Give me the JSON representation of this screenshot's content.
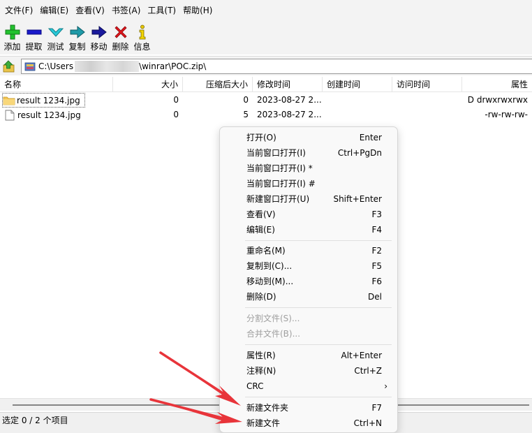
{
  "menubar": [
    "文件(F)",
    "编辑(E)",
    "查看(V)",
    "书签(A)",
    "工具(T)",
    "帮助(H)"
  ],
  "toolbar": [
    {
      "label": "添加",
      "icon": "add-icon"
    },
    {
      "label": "提取",
      "icon": "extract-icon"
    },
    {
      "label": "测试",
      "icon": "test-icon"
    },
    {
      "label": "复制",
      "icon": "copy-icon"
    },
    {
      "label": "移动",
      "icon": "move-icon"
    },
    {
      "label": "删除",
      "icon": "delete-icon"
    },
    {
      "label": "信息",
      "icon": "info-icon"
    }
  ],
  "address": {
    "prefix": "C:\\Users",
    "suffix": "\\winrar\\POC.zip\\"
  },
  "columns": [
    "名称",
    "大小",
    "压缩后大小",
    "修改时间",
    "创建时间",
    "访问时间",
    "属性"
  ],
  "files": [
    {
      "name": "result   1234.jpg",
      "type": "folder",
      "size": "0",
      "packed": "0",
      "modified": "2023-08-27 2...",
      "created": "",
      "accessed": "",
      "attrs": "D drwxrwxrwx"
    },
    {
      "name": "result   1234.jpg",
      "type": "file",
      "size": "0",
      "packed": "5",
      "modified": "2023-08-27 2...",
      "created": "",
      "accessed": "",
      "attrs": "-rw-rw-rw-"
    }
  ],
  "status": "选定 0 / 2 个项目",
  "context_menu": {
    "items": [
      {
        "label": "打开(O)",
        "shortcut": "Enter",
        "disabled": false
      },
      {
        "label": "当前窗口打开(I)",
        "shortcut": "Ctrl+PgDn",
        "disabled": false
      },
      {
        "label": "当前窗口打开(I) *",
        "shortcut": "",
        "disabled": false
      },
      {
        "label": "当前窗口打开(I) #",
        "shortcut": "",
        "disabled": false
      },
      {
        "label": "新建窗口打开(U)",
        "shortcut": "Shift+Enter",
        "disabled": false
      },
      {
        "label": "查看(V)",
        "shortcut": "F3",
        "disabled": false
      },
      {
        "label": "编辑(E)",
        "shortcut": "F4",
        "disabled": false
      },
      {
        "label": "重命名(M)",
        "shortcut": "F2",
        "disabled": false
      },
      {
        "label": "复制到(C)...",
        "shortcut": "F5",
        "disabled": false
      },
      {
        "label": "移动到(M)...",
        "shortcut": "F6",
        "disabled": false
      },
      {
        "label": "删除(D)",
        "shortcut": "Del",
        "disabled": false
      },
      {
        "label": "分割文件(S)...",
        "shortcut": "",
        "disabled": true
      },
      {
        "label": "合并文件(B)...",
        "shortcut": "",
        "disabled": true
      },
      {
        "label": "属性(R)",
        "shortcut": "Alt+Enter",
        "disabled": false
      },
      {
        "label": "注释(N)",
        "shortcut": "Ctrl+Z",
        "disabled": false
      },
      {
        "label": "CRC",
        "shortcut": "›",
        "disabled": false
      },
      {
        "label": "新建文件夹",
        "shortcut": "F7",
        "disabled": false
      },
      {
        "label": "新建文件",
        "shortcut": "Ctrl+N",
        "disabled": false
      }
    ]
  },
  "annotation_color": "#e8343a"
}
